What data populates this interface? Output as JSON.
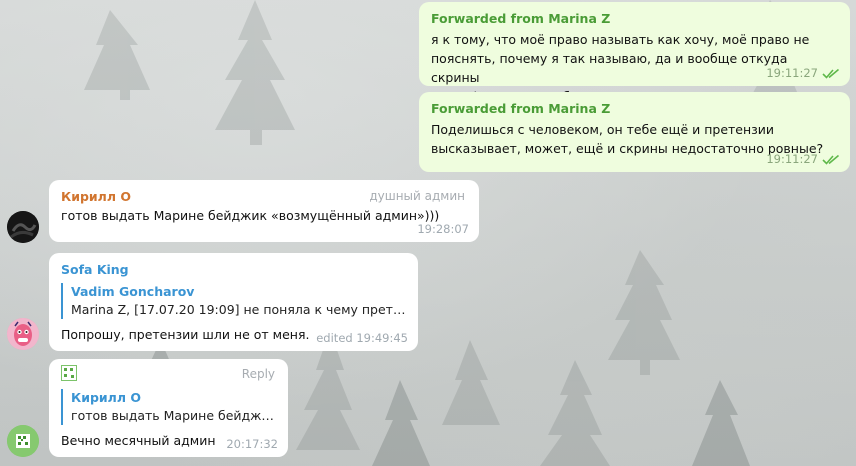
{
  "messages": {
    "fwd1": {
      "forward_label": "Forwarded from Marina Z",
      "line1": "я к тому, что моё право называть как хочу, моё право не",
      "line2": "пояснять, почему я так называю, да и вообще откуда скрины",
      "line3": "взяты ) Пусть спасибо скажет за интересную инфу",
      "time": "19:11:27"
    },
    "fwd2": {
      "forward_label": "Forwarded from Marina Z",
      "line1": "Поделишься с человеком, он тебе ещё и претензии",
      "line2": "высказывает, может, ещё и скрины недостаточно ровные?",
      "time": "19:11:27"
    },
    "kirill": {
      "sender": "Кирилл О",
      "sender_color": "#d1752f",
      "badge": "душный админ",
      "text": "готов выдать Марине бейджик «возмущённый админ»)))",
      "time": "19:28:07"
    },
    "sofa": {
      "sender": "Sofa King",
      "sender_color": "#3a94d3",
      "reply_name": "Vadim Goncharov",
      "reply_text": "Marina Z, [17.07.20 19:09] не поняла к чему претен...",
      "text": "Попрошу, претензии шли не от меня.",
      "time": "edited 19:49:45"
    },
    "last": {
      "action": "Reply",
      "reply_name": "Кирилл О",
      "reply_text": "готов выдать Марине бейджи...",
      "text": "Вечно месячный админ",
      "time": "20:17:32"
    }
  },
  "colors": {
    "outgoing_bubble": "#effdde",
    "incoming_bubble": "#ffffff",
    "forward_green": "#4a9c36",
    "reply_blue": "#3a94d3"
  },
  "icons": [
    "double-check-icon",
    "sticker-avatar-icon"
  ]
}
